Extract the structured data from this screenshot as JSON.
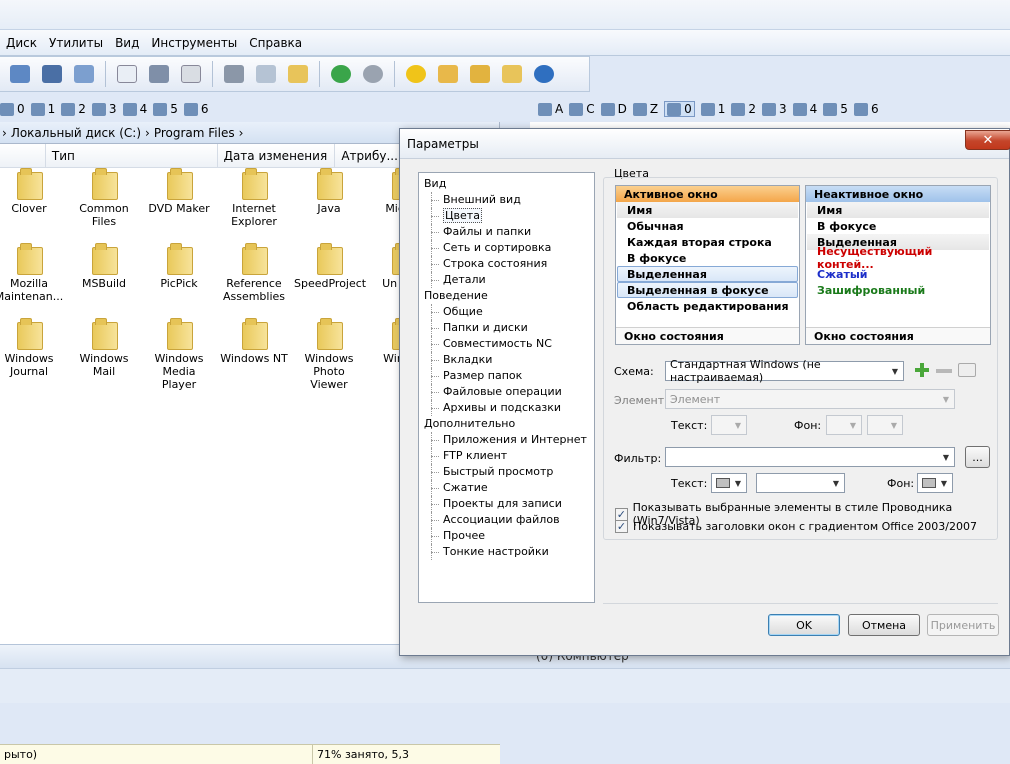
{
  "menu": [
    "Диск",
    "Утилиты",
    "Вид",
    "Инструменты",
    "Справка"
  ],
  "drives_left": [
    {
      "label": "0",
      "icon": "monitor-icon"
    },
    {
      "label": "1",
      "icon": "network-icon"
    },
    {
      "label": "2",
      "icon": "ie-icon"
    },
    {
      "label": "3",
      "icon": "desktop-icon"
    },
    {
      "label": "4",
      "icon": "film-icon"
    },
    {
      "label": "5",
      "icon": "book-icon"
    },
    {
      "label": "6",
      "icon": "disc-icon"
    }
  ],
  "drives_right": [
    {
      "label": "A",
      "icon": "floppy-icon"
    },
    {
      "label": "C",
      "icon": "hdd-icon"
    },
    {
      "label": "D",
      "icon": "cdrom-icon"
    },
    {
      "label": "Z",
      "icon": "netdrive-icon"
    },
    {
      "label": "0",
      "icon": "monitor-icon",
      "selected": true
    },
    {
      "label": "1",
      "icon": "network-icon"
    },
    {
      "label": "2",
      "icon": "ie-icon"
    },
    {
      "label": "3",
      "icon": "desktop-icon"
    },
    {
      "label": "4",
      "icon": "film-icon"
    },
    {
      "label": "5",
      "icon": "book-icon"
    },
    {
      "label": "6",
      "icon": "disc-icon"
    }
  ],
  "left_panel": {
    "path": [
      "Локальный диск (C:)",
      "Program Files"
    ],
    "columns": [
      "Тип",
      "Дата изменения",
      "Атрибу..."
    ],
    "status_left": "рыто)",
    "status_right": "71% занято, 5,3"
  },
  "files": [
    [
      "Clover",
      "Common Files",
      "DVD Maker",
      "Internet Explorer",
      "Java",
      "Mic Ga"
    ],
    [
      "Mozilla Maintenan...",
      "MSBuild",
      "PicPick",
      "Reference Assemblies",
      "SpeedProject",
      "Un Infor"
    ],
    [
      "Windows Journal",
      "Windows Mail",
      "Windows Media Player",
      "Windows NT",
      "Windows Photo Viewer",
      "Win Por"
    ]
  ],
  "bottom_status": "(0) Компьютер",
  "dialog": {
    "title": "Параметры",
    "close": "✕",
    "tree": [
      {
        "group": "Вид",
        "items": [
          "Внешний вид",
          "Цвета",
          "Файлы и папки",
          "Сеть и сортировка",
          "Строка состояния",
          "Детали"
        ]
      },
      {
        "group": "Поведение",
        "items": [
          "Общие",
          "Папки и диски",
          "Совместимость NC",
          "Вкладки",
          "Размер папок",
          "Файловые операции",
          "Архивы и подсказки"
        ]
      },
      {
        "group": "Дополнительно",
        "items": [
          "Приложения и Интернет",
          "FTP клиент",
          "Быстрый просмотр",
          "Сжатие",
          "Проекты для записи",
          "Ассоциации файлов",
          "Прочее",
          "Тонкие настройки"
        ]
      }
    ],
    "selected_item": "Цвета",
    "group_label": "Цвета",
    "active_window": {
      "header": "Активное окно",
      "rows": [
        "Имя",
        "Обычная",
        "Каждая вторая строка",
        "В фокусе",
        "Выделенная",
        "Выделенная в фокусе",
        "Область редактирования"
      ],
      "footer": "Окно состояния"
    },
    "inactive_window": {
      "header": "Неактивное окно",
      "rows": [
        "Имя",
        "В фокусе",
        "Выделенная",
        "Несуществующий контей...",
        "Сжатый",
        "Зашифрованный"
      ],
      "footer": "Окно состояния"
    },
    "colors": {
      "missing": "#cc0000",
      "compressed": "#1c2ec9",
      "encrypted": "#1a7a1a",
      "close_button": "#c4452a"
    },
    "scheme_label": "Схема:",
    "scheme_value": "Стандартная Windows (не настраиваемая)",
    "element_label": "Элемент:",
    "element_value": "Элемент",
    "text_label": "Текст:",
    "bg_label": "Фон:",
    "filter_label": "Фильтр:",
    "filter_value": "",
    "filter_browse": "...",
    "text2_label": "Текст:",
    "bg2_label": "Фон:",
    "check1": "Показывать выбранные элементы в стиле Проводника (Win7/Vista)",
    "check2": "Показывать заголовки окон с градиентом Office 2003/2007",
    "ok": "OK",
    "cancel": "Отмена",
    "apply": "Применить"
  }
}
